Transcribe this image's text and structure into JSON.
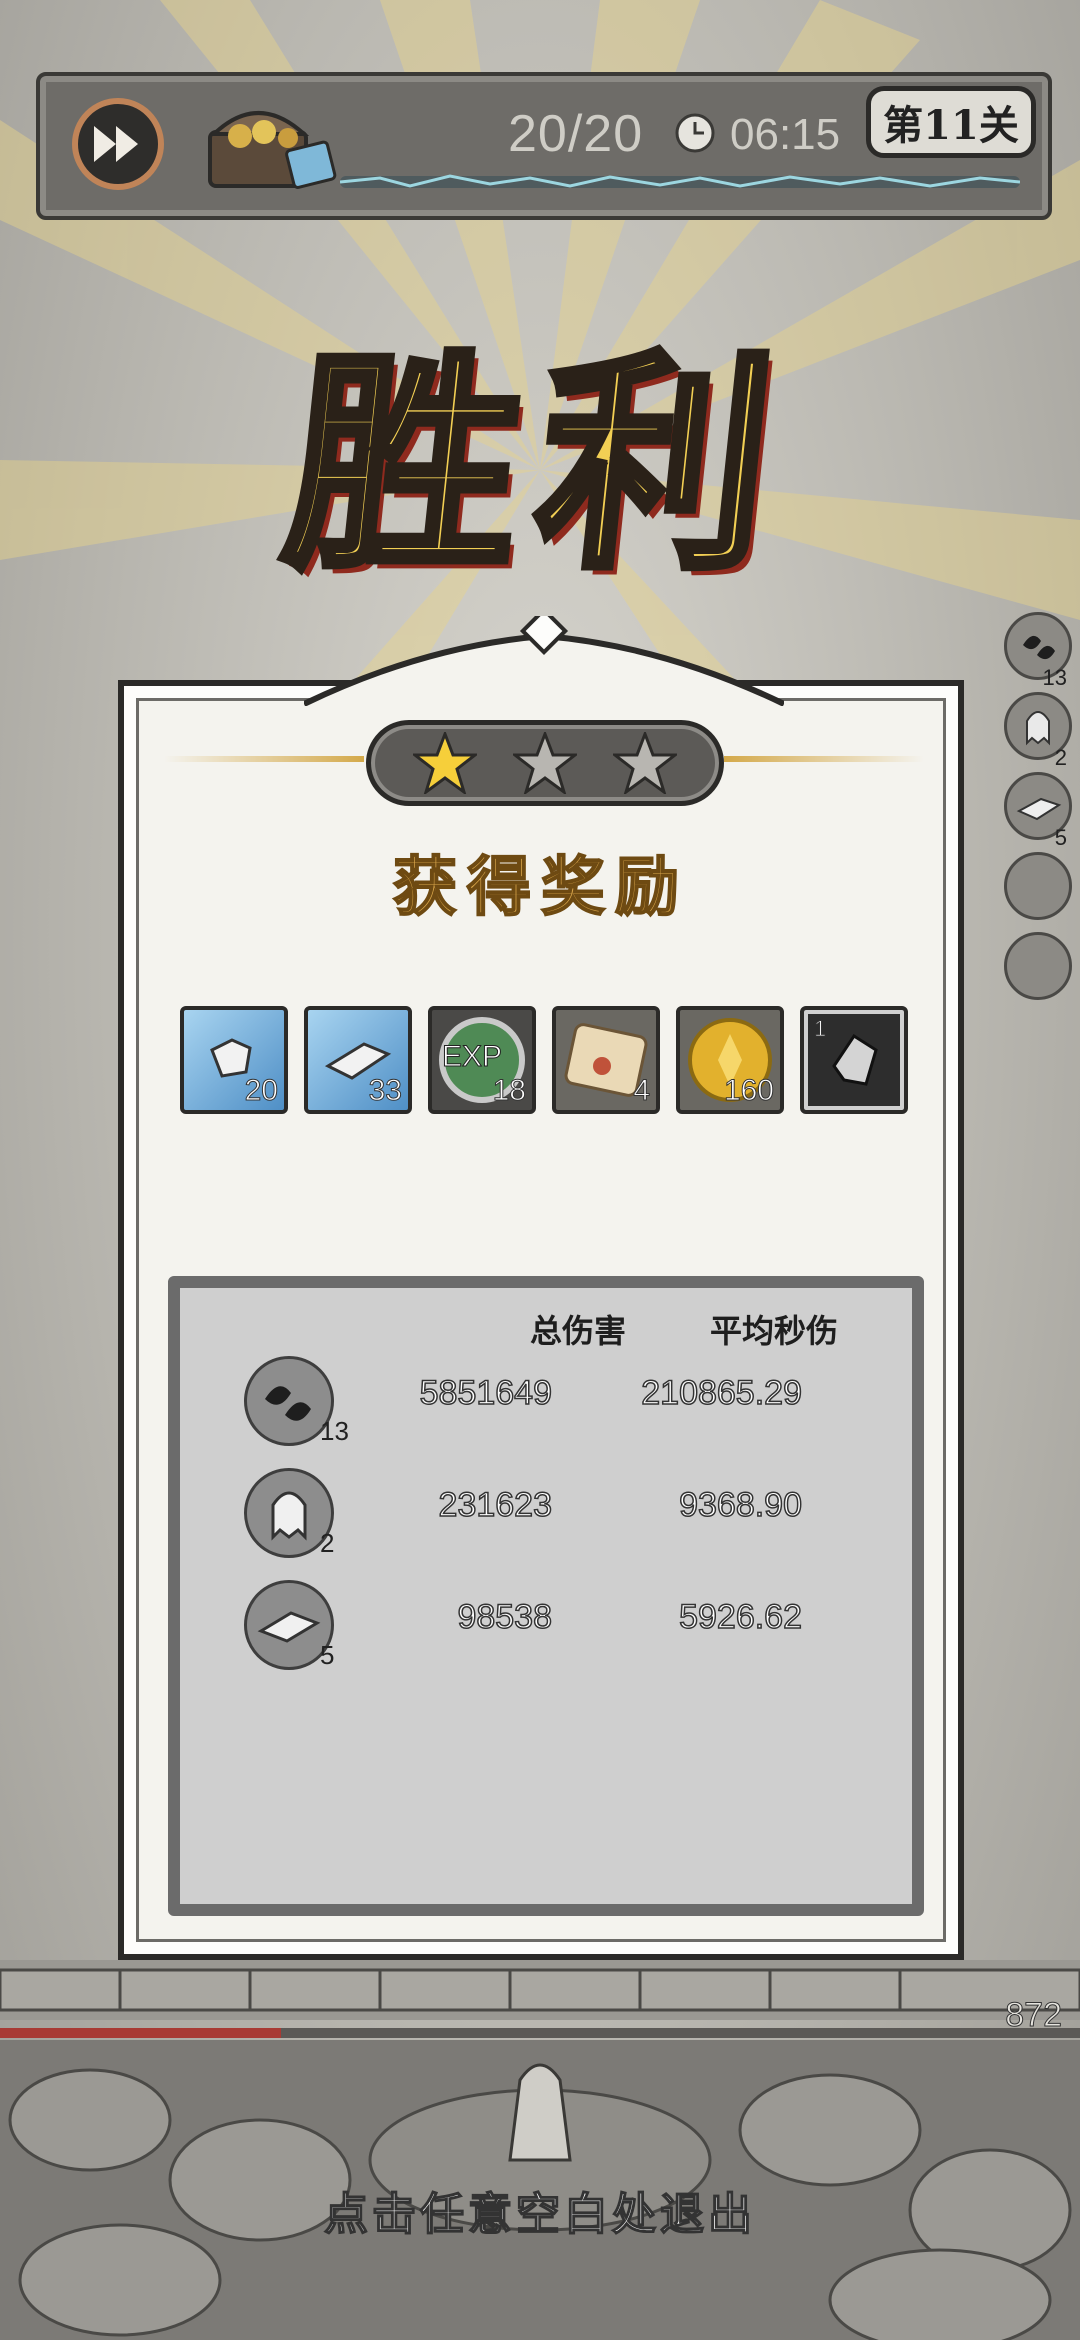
{
  "hud": {
    "wave_count": "20/20",
    "timer": "06:15",
    "level_label": "第11关",
    "fast_forward_icon": "fast-forward-icon",
    "clock_icon": "clock-icon",
    "chest_icon": "treasure-chest-icon"
  },
  "victory_title": "胜利",
  "result": {
    "stars_earned": 1,
    "stars_total": 3,
    "reward_title": "获得奖励",
    "rewards": [
      {
        "icon": "ice-rock-icon",
        "count": "20"
      },
      {
        "icon": "ice-shard-icon",
        "count": "33"
      },
      {
        "icon": "exp-orb-icon",
        "label": "EXP",
        "count": "18"
      },
      {
        "icon": "scroll-amulet-icon",
        "count": "4"
      },
      {
        "icon": "gold-coin-icon",
        "count": "160"
      },
      {
        "icon": "stone-shard-icon",
        "count": "1"
      }
    ],
    "stats_header": {
      "total_damage": "总伤害",
      "dps": "平均秒伤"
    },
    "stats_rows": [
      {
        "icon": "black-drops-skill-icon",
        "level": "13",
        "total_damage": "5851649",
        "dps": "210865.29"
      },
      {
        "icon": "ghost-skill-icon",
        "level": "2",
        "total_damage": "231623",
        "dps": "9368.90"
      },
      {
        "icon": "stone-block-skill-icon",
        "level": "5",
        "total_damage": "98538",
        "dps": "5926.62"
      }
    ]
  },
  "side_skills": [
    {
      "icon": "black-drops-skill-icon",
      "level": "13"
    },
    {
      "icon": "ghost-skill-icon",
      "level": "2"
    },
    {
      "icon": "stone-block-skill-icon",
      "level": "5"
    },
    {
      "icon": "empty-slot-icon",
      "level": ""
    },
    {
      "icon": "empty-slot-icon",
      "level": ""
    }
  ],
  "base": {
    "hp": "872",
    "hp_fraction": 0.26
  },
  "exit_hint": "点击任意空白处退出",
  "colors": {
    "gold": "#f2cf54",
    "panel": "#f4f3ee",
    "hp_red": "#a83a34",
    "title_gold": "#d8a54a"
  }
}
